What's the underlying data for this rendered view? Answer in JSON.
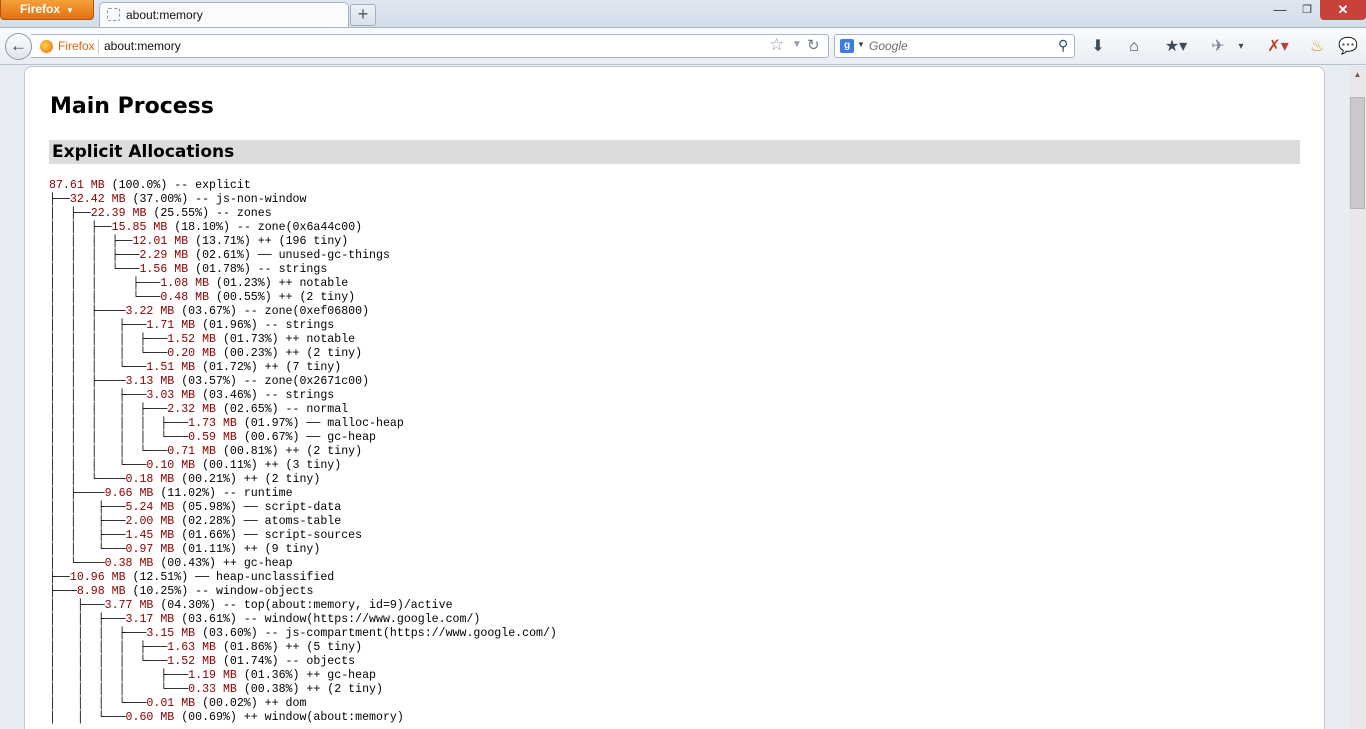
{
  "window": {
    "menu_label": "Firefox",
    "menu_arrow": "▼",
    "tab_title": "about:memory",
    "new_tab": "+",
    "minimize": "—",
    "maximize": "❐",
    "close": "✕"
  },
  "navbar": {
    "back": "←",
    "identity_label": "Firefox",
    "url": "about:memory",
    "star": "☆",
    "url_dropdown": "▼",
    "reload": "↻",
    "search_engine": "g",
    "search_engine_dropdown": "▼",
    "search_placeholder": "Google",
    "search_icon": "⚲",
    "toolbar": {
      "downloads": "⬇",
      "home": "⌂",
      "bookmarks": "★▾",
      "addon1": "✈",
      "separator": "▾",
      "addon2": "✗▾",
      "medal": "♨",
      "chat": "💬"
    }
  },
  "page": {
    "title": "Main Process",
    "section_title": "Explicit Allocations",
    "tree": [
      {
        "prefix": "",
        "size": "87.61 MB",
        "rest": " (100.0%) -- explicit"
      },
      {
        "prefix": "├──",
        "size": "32.42 MB",
        "rest": " (37.00%) -- js-non-window"
      },
      {
        "prefix": "│  ├──",
        "size": "22.39 MB",
        "rest": " (25.55%) -- zones"
      },
      {
        "prefix": "│  │  ├──",
        "size": "15.85 MB",
        "rest": " (18.10%) -- zone(0x6a44c00)"
      },
      {
        "prefix": "│  │  │  ├──",
        "size": "12.01 MB",
        "rest": " (13.71%) ++ (196 tiny)"
      },
      {
        "prefix": "│  │  │  ├───",
        "size": "2.29 MB",
        "rest": " (02.61%) ── unused-gc-things"
      },
      {
        "prefix": "│  │  │  └───",
        "size": "1.56 MB",
        "rest": " (01.78%) -- strings"
      },
      {
        "prefix": "│  │  │     ├───",
        "size": "1.08 MB",
        "rest": " (01.23%) ++ notable"
      },
      {
        "prefix": "│  │  │     └───",
        "size": "0.48 MB",
        "rest": " (00.55%) ++ (2 tiny)"
      },
      {
        "prefix": "│  │  ├────",
        "size": "3.22 MB",
        "rest": " (03.67%) -- zone(0xef06800)"
      },
      {
        "prefix": "│  │  │   ├───",
        "size": "1.71 MB",
        "rest": " (01.96%) -- strings"
      },
      {
        "prefix": "│  │  │   │  ├───",
        "size": "1.52 MB",
        "rest": " (01.73%) ++ notable"
      },
      {
        "prefix": "│  │  │   │  └───",
        "size": "0.20 MB",
        "rest": " (00.23%) ++ (2 tiny)"
      },
      {
        "prefix": "│  │  │   └───",
        "size": "1.51 MB",
        "rest": " (01.72%) ++ (7 tiny)"
      },
      {
        "prefix": "│  │  ├────",
        "size": "3.13 MB",
        "rest": " (03.57%) -- zone(0x2671c00)"
      },
      {
        "prefix": "│  │  │   ├───",
        "size": "3.03 MB",
        "rest": " (03.46%) -- strings"
      },
      {
        "prefix": "│  │  │   │  ├───",
        "size": "2.32 MB",
        "rest": " (02.65%) -- normal"
      },
      {
        "prefix": "│  │  │   │  │  ├───",
        "size": "1.73 MB",
        "rest": " (01.97%) ── malloc-heap"
      },
      {
        "prefix": "│  │  │   │  │  └───",
        "size": "0.59 MB",
        "rest": " (00.67%) ── gc-heap"
      },
      {
        "prefix": "│  │  │   │  └───",
        "size": "0.71 MB",
        "rest": " (00.81%) ++ (2 tiny)"
      },
      {
        "prefix": "│  │  │   └───",
        "size": "0.10 MB",
        "rest": " (00.11%) ++ (3 tiny)"
      },
      {
        "prefix": "│  │  └────",
        "size": "0.18 MB",
        "rest": " (00.21%) ++ (2 tiny)"
      },
      {
        "prefix": "│  ├────",
        "size": "9.66 MB",
        "rest": " (11.02%) -- runtime"
      },
      {
        "prefix": "│  │   ├───",
        "size": "5.24 MB",
        "rest": " (05.98%) ── script-data"
      },
      {
        "prefix": "│  │   ├───",
        "size": "2.00 MB",
        "rest": " (02.28%) ── atoms-table"
      },
      {
        "prefix": "│  │   ├───",
        "size": "1.45 MB",
        "rest": " (01.66%) ── script-sources"
      },
      {
        "prefix": "│  │   └───",
        "size": "0.97 MB",
        "rest": " (01.11%) ++ (9 tiny)"
      },
      {
        "prefix": "│  └────",
        "size": "0.38 MB",
        "rest": " (00.43%) ++ gc-heap"
      },
      {
        "prefix": "├──",
        "size": "10.96 MB",
        "rest": " (12.51%) ── heap-unclassified"
      },
      {
        "prefix": "├───",
        "size": "8.98 MB",
        "rest": " (10.25%) -- window-objects"
      },
      {
        "prefix": "│   ├───",
        "size": "3.77 MB",
        "rest": " (04.30%) -- top(about:memory, id=9)/active"
      },
      {
        "prefix": "│   │  ├───",
        "size": "3.17 MB",
        "rest": " (03.61%) -- window(https://www.google.com/)"
      },
      {
        "prefix": "│   │  │  ├───",
        "size": "3.15 MB",
        "rest": " (03.60%) -- js-compartment(https://www.google.com/)"
      },
      {
        "prefix": "│   │  │  │  ├───",
        "size": "1.63 MB",
        "rest": " (01.86%) ++ (5 tiny)"
      },
      {
        "prefix": "│   │  │  │  └───",
        "size": "1.52 MB",
        "rest": " (01.74%) -- objects"
      },
      {
        "prefix": "│   │  │  │     ├───",
        "size": "1.19 MB",
        "rest": " (01.36%) ++ gc-heap"
      },
      {
        "prefix": "│   │  │  │     └───",
        "size": "0.33 MB",
        "rest": " (00.38%) ++ (2 tiny)"
      },
      {
        "prefix": "│   │  │  └───",
        "size": "0.01 MB",
        "rest": " (00.02%) ++ dom"
      },
      {
        "prefix": "│   │  └───",
        "size": "0.60 MB",
        "rest": " (00.69%) ++ window(about:memory)"
      }
    ]
  }
}
